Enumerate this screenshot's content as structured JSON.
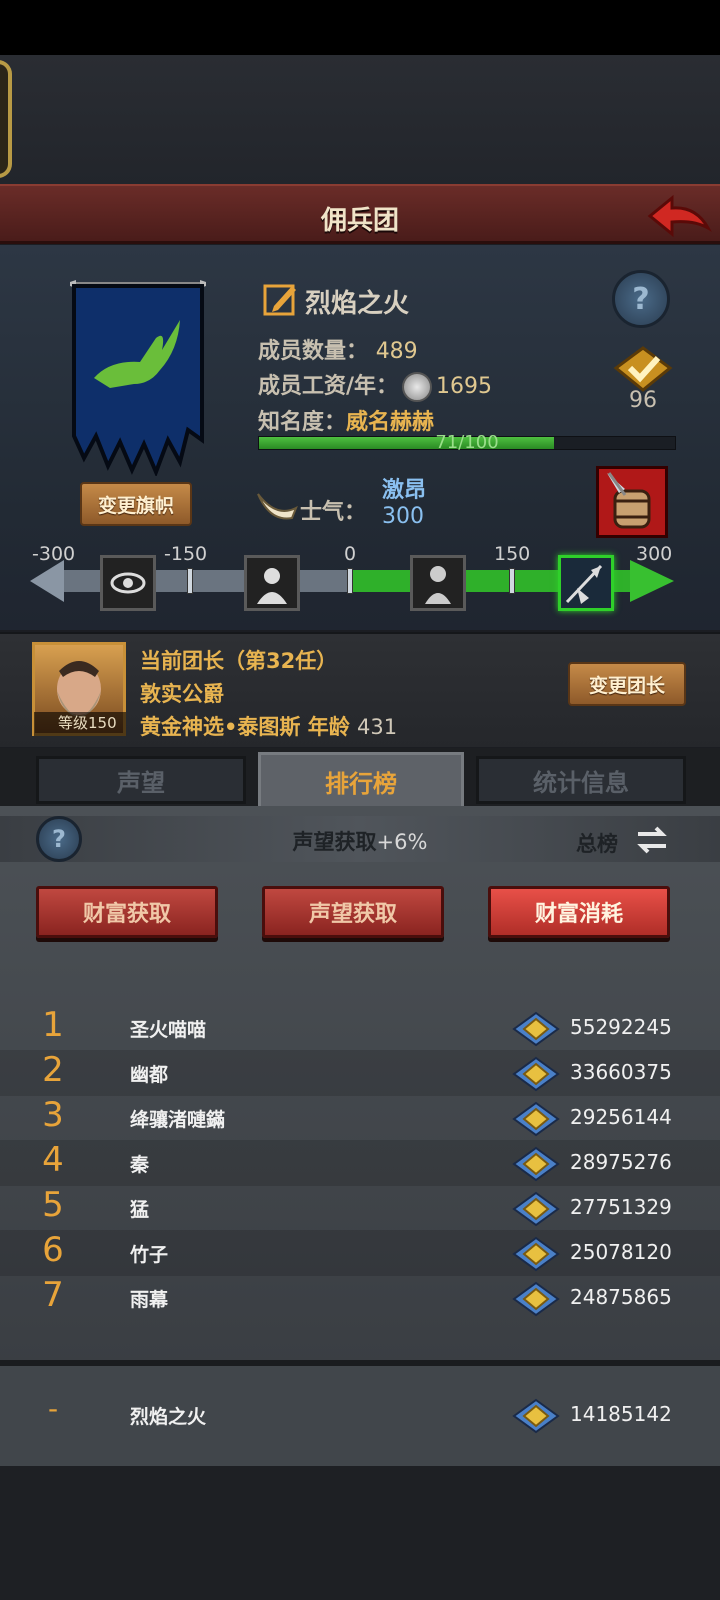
{
  "header": {
    "title": "佣兵团"
  },
  "guild": {
    "name": "烈焰之火",
    "member_count_label": "成员数量：",
    "member_count": "489",
    "salary_label": "成员工资/年：",
    "salary": "1695",
    "fame_label": "知名度：",
    "fame_value": "威名赫赫",
    "fame_progress_text": "71/100",
    "fame_progress_fraction": 0.71,
    "badge_value": "96",
    "change_banner_label": "变更旗帜",
    "morale_label": "士气：",
    "morale_state": "激昂",
    "morale_value": "300"
  },
  "morale_scale": {
    "ticks": [
      "-300",
      "-150",
      "0",
      "150",
      "300"
    ]
  },
  "leader": {
    "title": "当前团长（第32任）",
    "rank": "敦实公爵",
    "name": "黄金神选•泰图斯",
    "age_label": "年龄",
    "age": "431",
    "level_label": "等级150",
    "change_leader_label": "变更团长"
  },
  "tabs": [
    {
      "label": "声望",
      "active": false
    },
    {
      "label": "排行榜",
      "active": true
    },
    {
      "label": "统计信息",
      "active": false
    }
  ],
  "ranking": {
    "subtitle_main": "声望获取",
    "subtitle_bonus": "+6%",
    "scope_label": "总榜",
    "filters": [
      {
        "label": "财富获取",
        "active": false
      },
      {
        "label": "声望获取",
        "active": false
      },
      {
        "label": "财富消耗",
        "active": true
      }
    ],
    "rows": [
      {
        "rank": "1",
        "name": "圣火喵喵",
        "value": "55292245"
      },
      {
        "rank": "2",
        "name": "幽都",
        "value": "33660375"
      },
      {
        "rank": "3",
        "name": "绛骧渚嗹鏋",
        "value": "29256144"
      },
      {
        "rank": "4",
        "name": "秦",
        "value": "28975276"
      },
      {
        "rank": "5",
        "name": "猛",
        "value": "27751329"
      },
      {
        "rank": "6",
        "name": "竹子",
        "value": "25078120"
      },
      {
        "rank": "7",
        "name": "雨幕",
        "value": "24875865"
      }
    ],
    "self": {
      "rank": "-",
      "name": "烈焰之火",
      "value": "14185142"
    }
  },
  "colors": {
    "accent_gold": "#e8a43a",
    "morale_green": "#2fb02a",
    "title_red": "#6a2c28",
    "active_filter_red": "#e85048"
  }
}
